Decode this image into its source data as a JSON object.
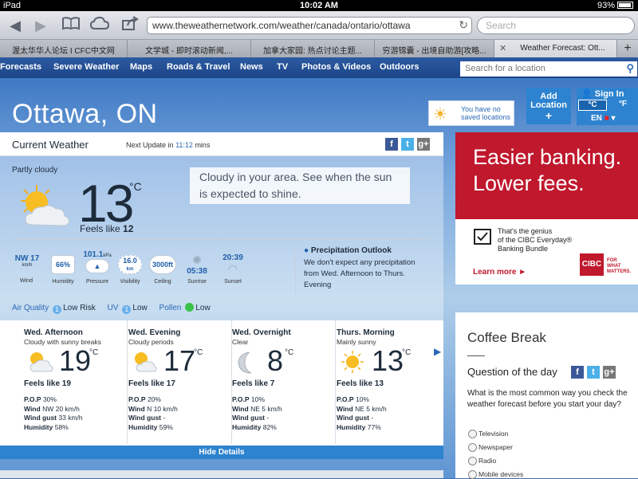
{
  "status": {
    "device": "iPad",
    "time": "10:02 AM",
    "battery": "93%"
  },
  "browser": {
    "url": "www.theweathernetwork.com/weather/canada/ontario/ottawa",
    "search_placeholder": "Search",
    "tabs": [
      "渥太华华人论坛 I CFC中文网",
      "文学城 - 即时滚动新闻,...",
      "加拿大家园: 热点讨论主题...",
      "穷游锦囊 - 出境自助游[攻略...",
      "Weather Forecast: Ott..."
    ]
  },
  "nav": {
    "items": [
      "Forecasts",
      "Severe Weather",
      "Maps",
      "Roads & Travel",
      "News",
      "TV",
      "Photos & Videos",
      "Outdoors"
    ],
    "search_placeholder": "Search for a location"
  },
  "location": {
    "city": "Ottawa, ON",
    "saved_text": "You have no saved locations",
    "add_label_1": "Add",
    "add_label_2": "Location",
    "add_plus": "+",
    "sign_in": "Sign In",
    "unit_c": "°C",
    "unit_f": "°F",
    "lang": "EN"
  },
  "current": {
    "title": "Current Weather",
    "next_update_pre": "Next Update in",
    "next_update_time": "11:12",
    "next_update_post": "mins",
    "condition": "Partly cloudy",
    "temp": "13",
    "unit": "°C",
    "feels_label": "Feels like",
    "feels_value": "12",
    "message": "Cloudy in your area. See when the sun is expected to shine.",
    "metrics": {
      "wind": {
        "value": "NW 17",
        "unit": "km/h",
        "label": "Wind"
      },
      "humidity": {
        "value": "66%",
        "label": "Humidity"
      },
      "pressure": {
        "value": "101.1",
        "unit": "kPa",
        "label": "Pressure"
      },
      "visibility": {
        "value": "16.0",
        "unit": "km",
        "label": "Visibility"
      },
      "ceiling": {
        "value": "3000ft",
        "label": "Ceiling"
      },
      "sunrise": {
        "value": "05:38",
        "label": "Sunrise"
      },
      "sunset": {
        "value": "20:39",
        "label": "Sunset"
      }
    },
    "precip_title": "Precipitation Outlook",
    "precip_text": "We don't expect any precipitation from Wed. Afternoon to Thurs. Evening",
    "air_quality_label": "Air Quality",
    "air_quality_index": "1",
    "air_quality_value": "Low Risk",
    "uv_label": "UV",
    "uv_index": "1",
    "uv_value": "Low",
    "pollen_label": "Pollen",
    "pollen_value": "Low"
  },
  "forecast": [
    {
      "period": "Wed. Afternoon",
      "desc": "Cloudy with sunny breaks",
      "temp": "19",
      "unit": "°C",
      "feels": "Feels like 19",
      "pop_label": "P.O.P",
      "pop": "30%",
      "wind_label": "Wind",
      "wind": "NW 20 km/h",
      "gust_label": "Wind gust",
      "gust": "33 km/h",
      "hum_label": "Humidity",
      "hum": "58%"
    },
    {
      "period": "Wed. Evening",
      "desc": "Cloudy periods",
      "temp": "17",
      "unit": "°C",
      "feels": "Feels like 17",
      "pop_label": "P.O.P",
      "pop": "20%",
      "wind_label": "Wind",
      "wind": "N 10 km/h",
      "gust_label": "Wind gust",
      "gust": "-",
      "hum_label": "Humidity",
      "hum": "59%"
    },
    {
      "period": "Wed. Overnight",
      "desc": "Clear",
      "temp": "8",
      "unit": "°C",
      "feels": "Feels like 7",
      "pop_label": "P.O.P",
      "pop": "10%",
      "wind_label": "Wind",
      "wind": "NE 5 km/h",
      "gust_label": "Wind gust",
      "gust": "-",
      "hum_label": "Humidity",
      "hum": "82%"
    },
    {
      "period": "Thurs. Morning",
      "desc": "Mainly sunny",
      "temp": "13",
      "unit": "°C",
      "feels": "Feels like 13",
      "pop_label": "P.O.P",
      "pop": "10%",
      "wind_label": "Wind",
      "wind": "NE 5 km/h",
      "gust_label": "Wind gust",
      "gust": "-",
      "hum_label": "Humidity",
      "hum": "77%"
    }
  ],
  "hide_details": "Hide Details",
  "ad": {
    "headline_1": "Easier banking.",
    "headline_2": "Lower fees.",
    "body_1": "That's the genius",
    "body_2": "of the CIBC Everyday®",
    "body_3": "Banking Bundle",
    "cta": "Learn more ►",
    "logo": "CIBC",
    "logo_tag_1": "FOR",
    "logo_tag_2": "WHAT",
    "logo_tag_3": "MATTERS."
  },
  "coffee": {
    "title": "Coffee Break",
    "qotd": "Question of the day",
    "question": "What is the most common way you check the weather forecast before you start your day?",
    "options": [
      "Television",
      "Newspaper",
      "Radio",
      "Mobile devices"
    ]
  }
}
